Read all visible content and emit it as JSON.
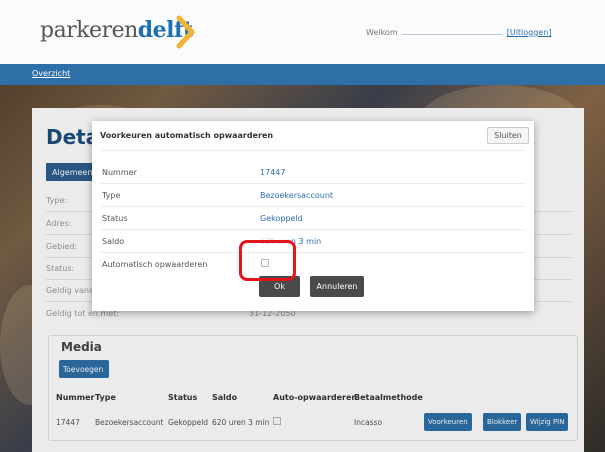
{
  "header": {
    "logo_part1": "parkeren",
    "logo_part2": "delft",
    "welcome_label": "Welkom",
    "logout_label": "[Uitloggen]",
    "logo_accent": "#1f6fb5",
    "chevron_color": "#f2b233"
  },
  "nav": {
    "overview_label": "Overzicht"
  },
  "page": {
    "title": "Detai",
    "tab_general": "Algemeen",
    "info": [
      {
        "label": "Type:",
        "value": ""
      },
      {
        "label": "Adres:",
        "value": ""
      },
      {
        "label": "Gebied:",
        "value": ""
      },
      {
        "label": "Status:",
        "value": ""
      },
      {
        "label": "Geldig vana",
        "value": ""
      },
      {
        "label": "Geldig tot en met:",
        "value": "31-12-2050"
      }
    ]
  },
  "media": {
    "title": "Media",
    "add_label": "Toevoegen",
    "headers": [
      "Nummer",
      "Type",
      "Status",
      "Saldo",
      "Auto-opwaarderen",
      "Betaalmethode"
    ],
    "row": {
      "number": "17447",
      "type": "Bezoekersaccount",
      "status": "Gekoppeld",
      "balance": "620 uren 3 min",
      "payment": "Incasso"
    },
    "actions": [
      "Voorkeuren",
      "Blokkeer",
      "Wijzig PIN"
    ]
  },
  "modal": {
    "title": "Voorkeuren automatisch opwaarderen",
    "close_label": "Sluiten",
    "rows": [
      {
        "label": "Nummer",
        "value": "17447"
      },
      {
        "label": "Type",
        "value": "Bezoekersaccount"
      },
      {
        "label": "Status",
        "value": "Gekoppeld"
      },
      {
        "label": "Saldo",
        "value": "620 uren 3 min"
      },
      {
        "label": "Automatisch opwaarderen",
        "value": ""
      }
    ],
    "ok_label": "Ok",
    "cancel_label": "Annuleren"
  },
  "colors": {
    "nav_bg": "#2f6fa8",
    "primary": "#2d6fa8",
    "highlight": "#e4141b"
  }
}
